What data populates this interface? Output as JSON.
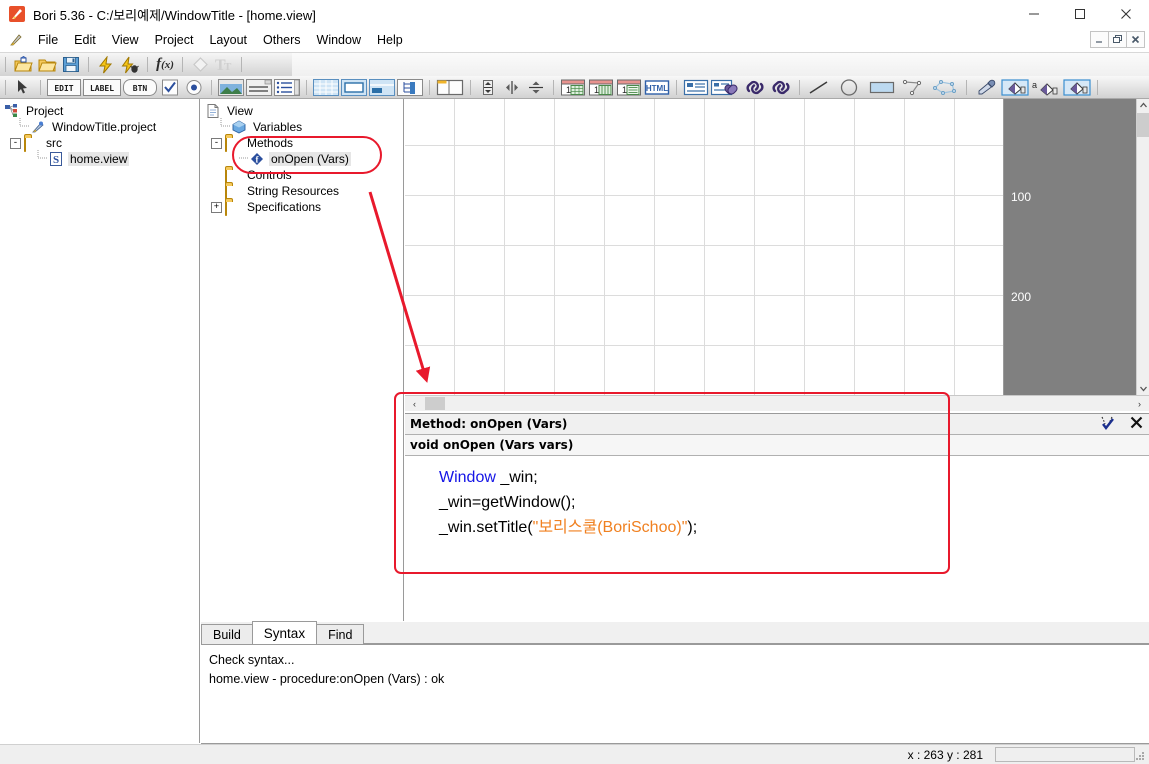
{
  "window": {
    "title": "Bori 5.36 - C:/보리예제/WindowTitle - [home.view]",
    "app_icon": "bori-feather-icon",
    "minimize": "–",
    "maximize": "☐",
    "close": "✕"
  },
  "mdi": {
    "minimize": "–",
    "restore": "❐",
    "close": "✖"
  },
  "menu": {
    "items": [
      {
        "label": "File",
        "name": "menu-file"
      },
      {
        "label": "Edit",
        "name": "menu-edit"
      },
      {
        "label": "View",
        "name": "menu-view"
      },
      {
        "label": "Project",
        "name": "menu-project"
      },
      {
        "label": "Layout",
        "name": "menu-layout"
      },
      {
        "label": "Others",
        "name": "menu-others"
      },
      {
        "label": "Window",
        "name": "menu-window"
      },
      {
        "label": "Help",
        "name": "menu-help"
      }
    ]
  },
  "toolbar1": {
    "icons": [
      "new-project-icon",
      "open-folder-icon",
      "save-icon",
      "run-icon",
      "debug-icon",
      "function-icon",
      "shape-icon",
      "text-format-icon"
    ]
  },
  "toolbar2": {
    "icons": [
      "pointer-icon",
      "edit-field-icon",
      "label-icon",
      "button-icon",
      "checkbox-icon",
      "radio-icon",
      "image-icon",
      "panel-icon",
      "listbox-icon",
      "grid-icon",
      "tabview-icon",
      "splitview-icon",
      "treeview-icon",
      "window-icon",
      "vertical-align-icon",
      "align-center-v-icon",
      "align-center-h-icon",
      "calendar-icon",
      "datepicker-icon",
      "listview-icon",
      "html-icon",
      "property-icon",
      "link-data-icon",
      "link-icon",
      "link-alt-icon",
      "line-icon",
      "ellipse-icon",
      "rectangle-icon",
      "polyline-icon",
      "polygon-icon",
      "eyedropper-icon",
      "fill-color-icon",
      "text-color-icon",
      "border-color-icon"
    ],
    "labels": {
      "edit": "EDIT",
      "label": "LABEL",
      "button": "BTN",
      "html": "HTML",
      "text_color": "a"
    }
  },
  "project_tree": {
    "title": "Project",
    "root_icon": "project-root-icon",
    "items": [
      {
        "label": "Project",
        "icon": "project-root-icon",
        "level": 0,
        "expander": "",
        "selected": false
      },
      {
        "label": "WindowTitle.project",
        "icon": "project-file-icon",
        "level": 1,
        "expander": "",
        "selected": false
      },
      {
        "label": "src",
        "icon": "folder-icon",
        "level": 1,
        "expander": "-",
        "selected": false
      },
      {
        "label": "home.view",
        "icon": "view-file-icon",
        "level": 2,
        "expander": "",
        "selected": true
      }
    ]
  },
  "view_tree": {
    "items": [
      {
        "label": "View",
        "icon": "view-doc-icon",
        "level": 0,
        "expander": "",
        "selected": false
      },
      {
        "label": "Variables",
        "icon": "variables-icon",
        "level": 1,
        "expander": "",
        "selected": false
      },
      {
        "label": "Methods",
        "icon": "folder-icon",
        "level": 1,
        "expander": "-",
        "selected": false
      },
      {
        "label": "onOpen (Vars)",
        "icon": "method-icon",
        "level": 2,
        "expander": "",
        "selected": true
      },
      {
        "label": "Controls",
        "icon": "folder-icon",
        "level": 1,
        "expander": "",
        "selected": false
      },
      {
        "label": "String Resources",
        "icon": "folder-icon",
        "level": 1,
        "expander": "",
        "selected": false
      },
      {
        "label": "Specifications",
        "icon": "folder-icon",
        "level": 1,
        "expander": "+",
        "selected": false
      }
    ]
  },
  "canvas": {
    "ruler_labels": [
      "100",
      "200"
    ],
    "ruler_color": "#808080",
    "grid_size_px": 50,
    "hscroll": {
      "left_arrow": "‹",
      "right_arrow": "›"
    },
    "vscroll": {
      "up_arrow": "˄",
      "down_arrow": "˅"
    }
  },
  "method_panel": {
    "header_title": "Method: onOpen (Vars)",
    "check_icon": "syntax-check-icon",
    "close_icon": "close-icon",
    "signature": "void onOpen (Vars vars)",
    "code_lines": [
      {
        "parts": [
          {
            "text": "Window",
            "style": "kw"
          },
          {
            "text": " _win;",
            "style": "plain"
          }
        ]
      },
      {
        "parts": [
          {
            "text": "_win=getWindow();",
            "style": "plain"
          }
        ]
      },
      {
        "parts": [
          {
            "text": "_win.setTitle(",
            "style": "plain"
          },
          {
            "text": "\"보리스쿨(BoriSchoo)\"",
            "style": "str"
          },
          {
            "text": ");",
            "style": "plain"
          }
        ]
      }
    ]
  },
  "output_panel": {
    "tabs": [
      {
        "label": "Build",
        "active": false
      },
      {
        "label": "Syntax",
        "active": true
      },
      {
        "label": "Find",
        "active": false
      }
    ],
    "lines": [
      "Check syntax...",
      "home.view - procedure:onOpen (Vars) : ok"
    ]
  },
  "statusbar": {
    "coords": "x : 263  y : 281",
    "slot_value": ""
  },
  "annotations": {
    "highlight_color": "#e8192c",
    "ellipse_target": "onOpen (Vars)",
    "rect_target": "method-editor",
    "arrow": "points-from-tree-to-method-editor"
  }
}
